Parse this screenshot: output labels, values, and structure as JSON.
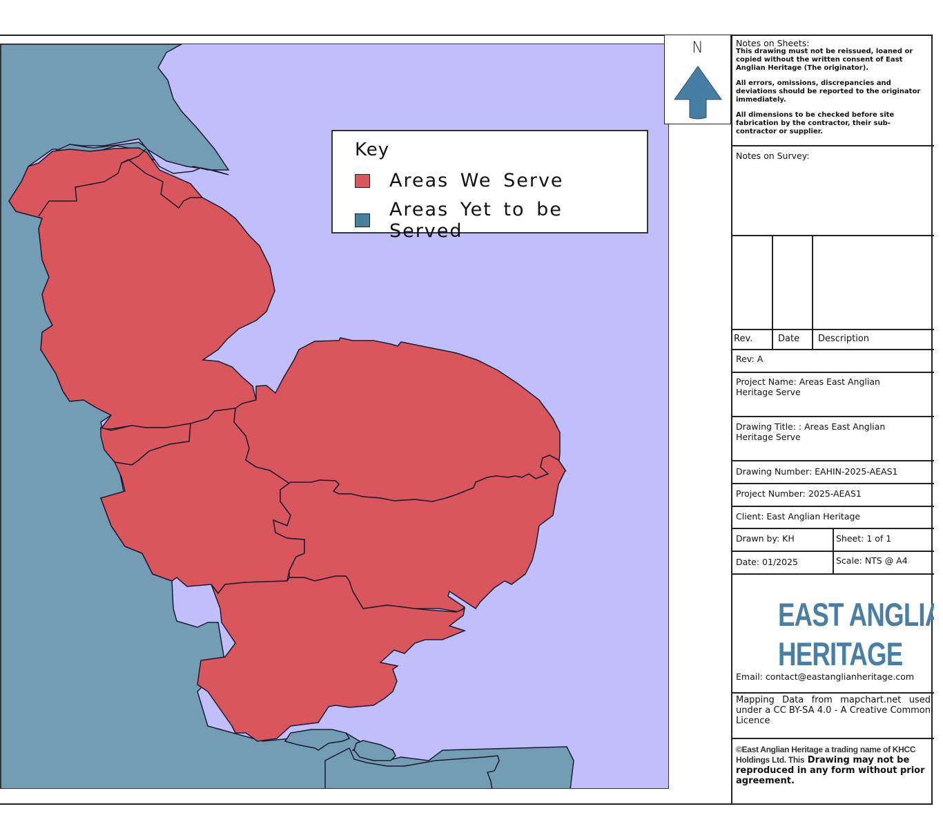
{
  "map": {
    "colors": {
      "sea": "#c0bffb",
      "served": "#d9575c",
      "unserved": "#729db5",
      "outline": "#1a1a2e"
    }
  },
  "north": {
    "letter": "N",
    "icon": "north-arrow-icon",
    "arrow_color": "#467fa3"
  },
  "key": {
    "title": "Key",
    "items": [
      {
        "label": "Areas We Serve",
        "color": "#d9575c"
      },
      {
        "label": "Areas Yet to be Served",
        "color": "#45809f"
      }
    ]
  },
  "title_block": {
    "notes_on_sheets": {
      "heading": "Notes on Sheets:",
      "paragraphs": [
        "This drawing must not be reissued, loaned or copied without the written consent of East Anglian Heritage (The originator).",
        "All errors, omissions, discrepancies and deviations should be reported to the originator immediately.",
        "All dimensions to be checked before site fabrication by the contractor, their sub-contractor or supplier."
      ]
    },
    "notes_on_survey": "Notes on Survey:",
    "revision_table": {
      "headers": [
        "Rev.",
        "Date",
        "Description"
      ],
      "rows": []
    },
    "rev": "Rev:  A",
    "project_name": "Project Name: Areas East Anglian Heritage Serve",
    "drawing_title": "Drawing Title: : Areas East Anglian Heritage Serve",
    "drawing_number": "Drawing Number: EAHIN-2025-AEAS1",
    "project_number": "Project Number:  2025-AEAS1",
    "client": "Client: East Anglian Heritage",
    "drawn_by": "Drawn by:  KH",
    "sheet": "Sheet:  1 of 1",
    "date": "Date:  01/2025",
    "scale": "Scale:  NTS @ A4",
    "logo_line1": "EAST ANGLIAN",
    "logo_line2": "HERITAGE",
    "logo_color": "#4a7fa5",
    "email": "Email: contact@eastanglianheritage.com",
    "mapping_credit": "Mapping Data from mapchart.net used under a CC BY-SA 4.0 - A Creative Common Licence",
    "copyright_prefix": "©East Anglian Heritage a trading name of KHCC Holdings Ltd. This",
    "copyright_suffix": " Drawing may not be reproduced in any form without prior agreement."
  }
}
